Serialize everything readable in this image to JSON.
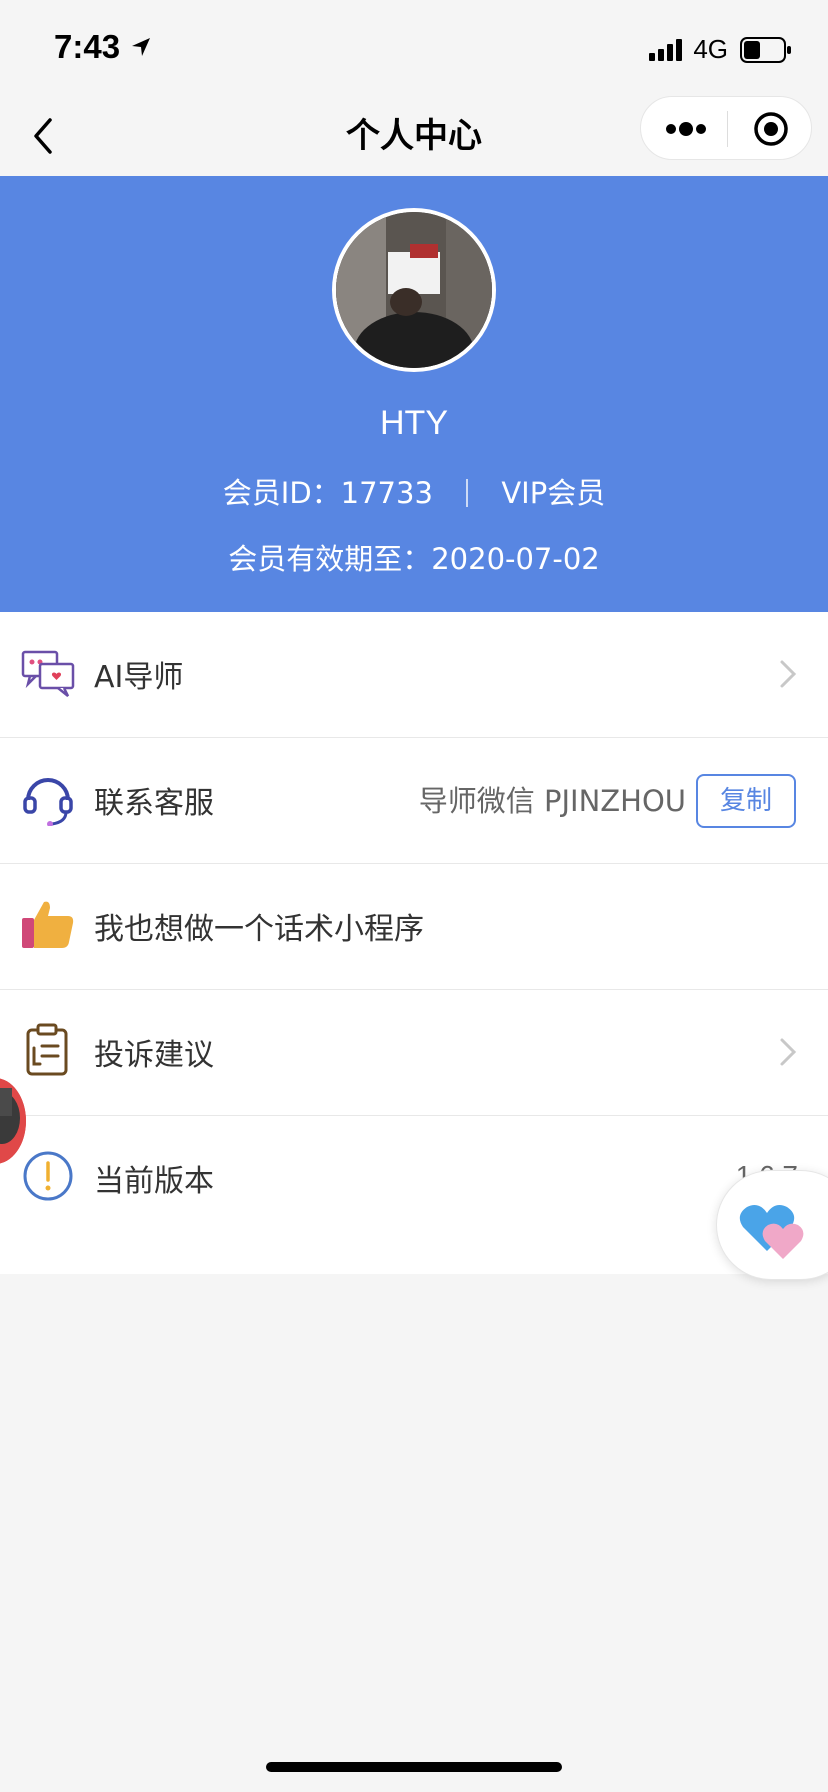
{
  "status_bar": {
    "time": "7:43",
    "network": "4G"
  },
  "nav": {
    "title": "个人中心"
  },
  "profile": {
    "username": "HTY",
    "member_id_label": "会员ID：17733",
    "member_level": "VIP会员",
    "expire_label": "会员有效期至：2020-07-02"
  },
  "menu": [
    {
      "label": "AI导师",
      "icon": "chat-bubbles-icon"
    },
    {
      "label": "联系客服",
      "icon": "headset-icon",
      "extra": "导师微信 PJINZHOU",
      "button": "复制"
    },
    {
      "label": "我也想做一个话术小程序",
      "icon": "thumbs-up-icon"
    },
    {
      "label": "投诉建议",
      "icon": "clipboard-icon"
    },
    {
      "label": "当前版本",
      "icon": "info-circle-icon",
      "value": "1.6.7"
    }
  ],
  "colors": {
    "header_bg": "#5886e2",
    "accent": "#5886e2",
    "page_bg": "#f5f5f5"
  }
}
